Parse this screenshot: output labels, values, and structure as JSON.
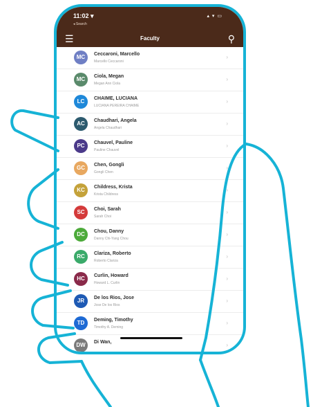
{
  "status": {
    "time": "11:02 ▾",
    "back_label": "◂ Search",
    "icons": "▴ ▾ ▭"
  },
  "nav": {
    "title": "Faculty",
    "menu_icon": "☰",
    "search_icon": "⚲"
  },
  "chevron": "›",
  "faculty": [
    {
      "name": "Ceccaroni, Marcello",
      "sub": "Marcello Ceccaroni",
      "initials": "MC",
      "color": "#6f7fc4"
    },
    {
      "name": "Ciola, Megan",
      "sub": "Megan Ann Ciola",
      "initials": "MC",
      "color": "#5a8a6b"
    },
    {
      "name": "CHAIME, LUCIANA",
      "sub": "LUCIANA PEREIRA CHAIME",
      "initials": "LC",
      "color": "#1e88d9"
    },
    {
      "name": "Chaudhari, Angela",
      "sub": "Angela Chaudhari",
      "initials": "AC",
      "color": "#2c5a6e"
    },
    {
      "name": "Chauvel, Pauline",
      "sub": "Pauline Chauvel",
      "initials": "PC",
      "color": "#4b3a8a"
    },
    {
      "name": "Chen, Gongli",
      "sub": "Gongli Chen",
      "initials": "GC",
      "color": "#e8a860"
    },
    {
      "name": "Childress, Krista",
      "sub": "Krista Childress",
      "initials": "KC",
      "color": "#c4a23a"
    },
    {
      "name": "Choi, Sarah",
      "sub": "Sarah Choi",
      "initials": "SC",
      "color": "#d43a3a"
    },
    {
      "name": "Chou, Danny",
      "sub": "Danny Chi-Yang Chou",
      "initials": "DC",
      "color": "#4caa3a"
    },
    {
      "name": "Clariza, Roberto",
      "sub": "Roberto Clariza",
      "initials": "RC",
      "color": "#3aaa6a"
    },
    {
      "name": "Curlin, Howard",
      "sub": "Howard L. Curlin",
      "initials": "HC",
      "color": "#8a2a4a"
    },
    {
      "name": "De los Rios, Jose",
      "sub": "Jose De los Rios",
      "initials": "JR",
      "color": "#1e5ab4"
    },
    {
      "name": "Deming, Timothy",
      "sub": "Timothy A. Deming",
      "initials": "TD",
      "color": "#1e6ad4"
    },
    {
      "name": "Di Wan,",
      "sub": "",
      "initials": "DW",
      "color": "#7a7a7a"
    }
  ]
}
